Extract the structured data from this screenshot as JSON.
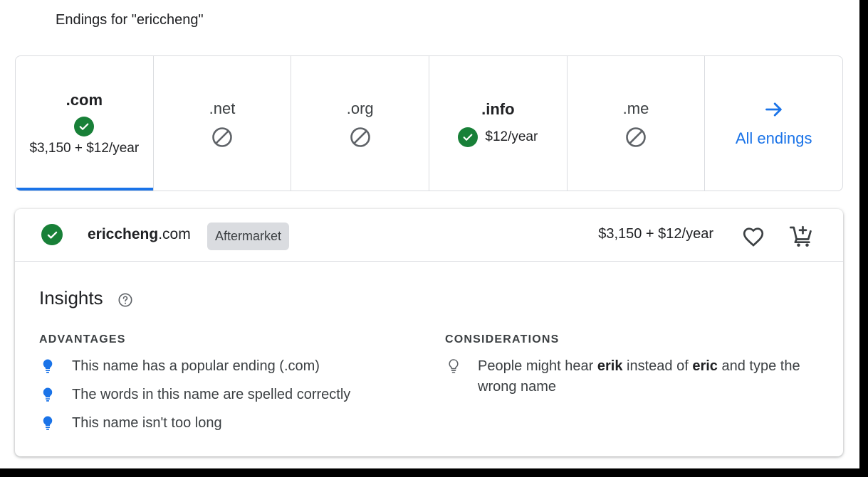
{
  "heading": "Endings for \"ericcheng\"",
  "endings": [
    {
      "tld": ".com",
      "status": "available",
      "price": "$3,150 + $12/year",
      "selected": true
    },
    {
      "tld": ".net",
      "status": "unavailable"
    },
    {
      "tld": ".org",
      "status": "unavailable"
    },
    {
      "tld": ".info",
      "status": "available",
      "price": "$12/year"
    },
    {
      "tld": ".me",
      "status": "unavailable"
    }
  ],
  "all_endings_label": "All endings",
  "result": {
    "sld": "ericcheng",
    "tld": ".com",
    "badge": "Aftermarket",
    "price": "$3,150 + $12/year"
  },
  "insights": {
    "title": "Insights",
    "advantages": {
      "title": "ADVANTAGES",
      "items": [
        "This name has a popular ending (.com)",
        "The words in this name are spelled correctly",
        "This name isn't too long"
      ]
    },
    "considerations": {
      "title": "CONSIDERATIONS",
      "line_parts": [
        "People might hear ",
        "erik",
        " instead of ",
        "eric",
        " and type the wrong name"
      ]
    }
  },
  "colors": {
    "accent": "#1a73e8",
    "available": "#188038",
    "advantage_bulb": "#1a73e8"
  }
}
